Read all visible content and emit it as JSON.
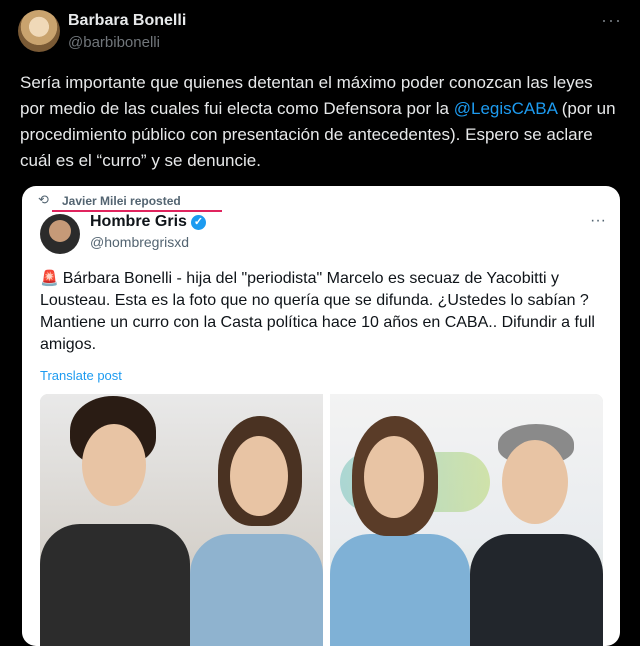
{
  "post": {
    "author_name": "Barbara Bonelli",
    "author_handle": "@barbibonelli",
    "more_label": "···",
    "text_part1": "Sería importante que quienes detentan el máximo poder conozcan las leyes por medio de las cuales fui electa como Defensora por la ",
    "mention": "@LegisCABA",
    "text_part2": " (por un procedimiento público con presentación de antecedentes). Espero se aclare cuál es el “curro” y se denuncie."
  },
  "quote": {
    "repost_label": "Javier Milei reposted",
    "repost_icon": "repost-icon",
    "author_name": "Hombre Gris",
    "author_handle": "@hombregrisxd",
    "more_label": "···",
    "siren_icon": "🚨",
    "text": "Bárbara Bonelli - hija del \"periodista\" Marcelo es secuaz de Yacobitti y Lousteau.  Esta es la foto que no quería que se difunda. ¿Ustedes lo sabían ? Mantiene un curro con la Casta política hace 10 años en CABA.. Difundir a full amigos.",
    "translate_label": "Translate post"
  },
  "colors": {
    "background": "#000000",
    "text": "#e7e9ea",
    "muted": "#71767b",
    "link": "#1d9bf0",
    "card_bg": "#ffffff",
    "underline": "#e0245e"
  }
}
